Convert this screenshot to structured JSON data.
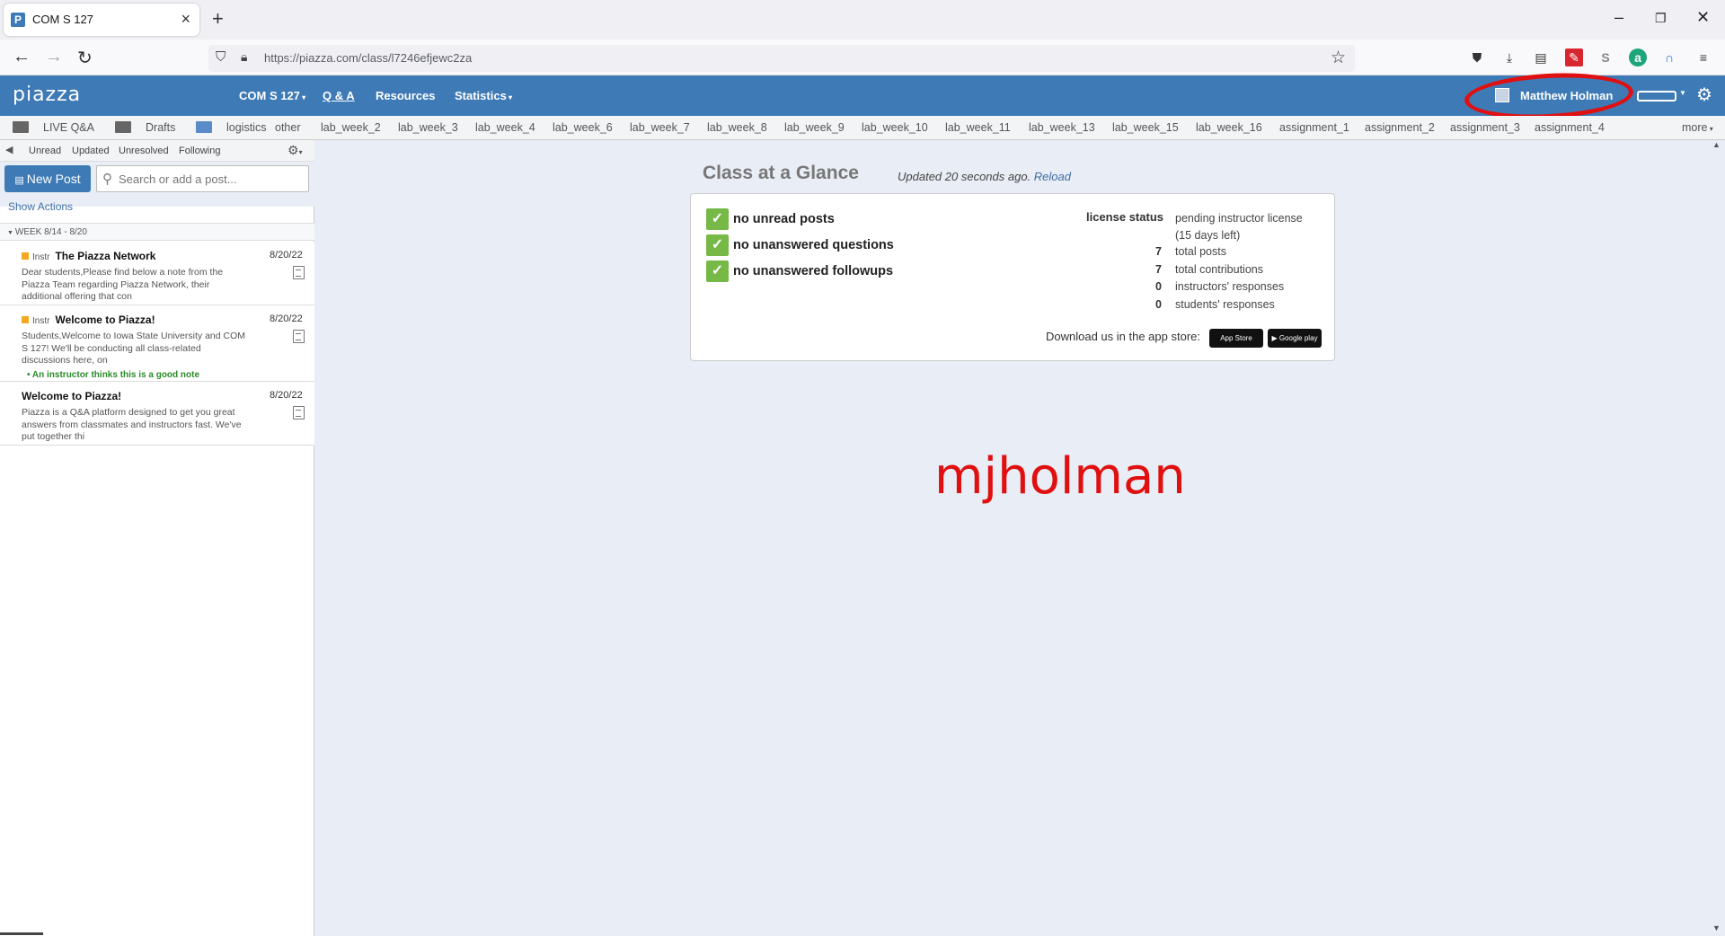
{
  "browser": {
    "tab_title": "COM S 127",
    "tab_favicon": "P",
    "url": "https://piazza.com/class/l7246efjewc2za"
  },
  "header": {
    "logo": "piazza",
    "course": "COM S 127",
    "qa": "Q & A",
    "resources": "Resources",
    "statistics": "Statistics",
    "user_name": "Matthew Holman",
    "accent_color": "#3e7ab6"
  },
  "folders": {
    "live_qa": "LIVE Q&A",
    "drafts": "Drafts",
    "items": [
      "logistics",
      "other",
      "lab_week_2",
      "lab_week_3",
      "lab_week_4",
      "lab_week_6",
      "lab_week_7",
      "lab_week_8",
      "lab_week_9",
      "lab_week_10",
      "lab_week_11",
      "lab_week_13",
      "lab_week_15",
      "lab_week_16",
      "assignment_1",
      "assignment_2",
      "assignment_3",
      "assignment_4"
    ],
    "more": "more"
  },
  "filters": [
    "Unread",
    "Updated",
    "Unresolved",
    "Following"
  ],
  "left": {
    "new_post": "New Post",
    "search_placeholder": "Search or add a post...",
    "show_actions": "Show Actions",
    "week_label": "WEEK 8/14 - 8/20",
    "posts": [
      {
        "tag": "Instr",
        "title": "The Piazza Network",
        "date": "8/20/22",
        "body": "Dear students,Please find below a note from the Piazza Team regarding Piazza Network, their additional offering that con",
        "note": ""
      },
      {
        "tag": "Instr",
        "title": "Welcome to Piazza!",
        "date": "8/20/22",
        "body": "Students,Welcome to Iowa State University and COM S 127! We'll be conducting all class-related discussions here, on",
        "note": "An instructor thinks this is a good note"
      },
      {
        "tag": "",
        "title": "Welcome to Piazza!",
        "date": "8/20/22",
        "body": "Piazza is a Q&A platform designed to get you great answers from classmates and instructors fast. We've put together thi",
        "note": ""
      }
    ]
  },
  "glance": {
    "title": "Class at a Glance",
    "updated": "Updated 20 seconds ago.",
    "reload": "Reload",
    "checks": [
      "no unread posts",
      "no unanswered questions",
      "no unanswered followups"
    ],
    "license_label": "license status",
    "license_value": "pending instructor license (15 days left)",
    "stats": [
      {
        "num": "7",
        "label": "total posts"
      },
      {
        "num": "7",
        "label": "total contributions"
      },
      {
        "num": "0",
        "label": "instructors' responses"
      },
      {
        "num": "0",
        "label": "students' responses"
      }
    ],
    "download": "Download us in the app store:",
    "app_store": "App Store",
    "google_play": "Google play"
  },
  "watermark": "mjholman"
}
